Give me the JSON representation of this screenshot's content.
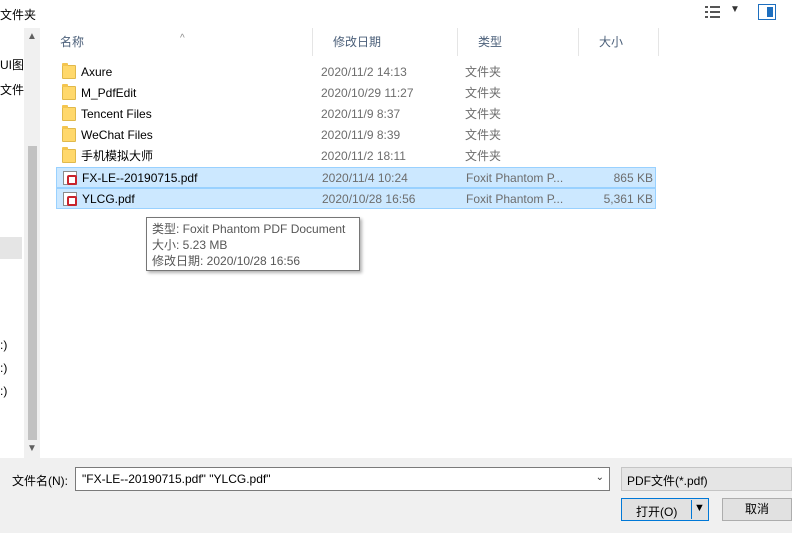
{
  "toolbar": {
    "left_label": "文件夹",
    "view_icon": "details-view-icon",
    "view_dropdown_icon": "chevron-down-icon",
    "preview_pane_icon": "preview-pane-icon"
  },
  "nav": {
    "items": [
      "UI图",
      "文件:",
      ":)",
      ":)",
      ":)"
    ]
  },
  "columns": {
    "name": "名称",
    "date": "修改日期",
    "type": "类型",
    "size": "大小"
  },
  "files": [
    {
      "name": "Axure",
      "date": "2020/11/2 14:13",
      "type": "文件夹",
      "size": "",
      "kind": "folder"
    },
    {
      "name": "M_PdfEdit",
      "date": "2020/10/29 11:27",
      "type": "文件夹",
      "size": "",
      "kind": "folder"
    },
    {
      "name": "Tencent Files",
      "date": "2020/11/9 8:37",
      "type": "文件夹",
      "size": "",
      "kind": "folder"
    },
    {
      "name": "WeChat Files",
      "date": "2020/11/9 8:39",
      "type": "文件夹",
      "size": "",
      "kind": "folder"
    },
    {
      "name": "手机模拟大师",
      "date": "2020/11/2 18:11",
      "type": "文件夹",
      "size": "",
      "kind": "folder"
    },
    {
      "name": "FX-LE--20190715.pdf",
      "date": "2020/11/4 10:24",
      "type": "Foxit Phantom P...",
      "size": "865 KB",
      "kind": "pdf",
      "selected": true
    },
    {
      "name": "YLCG.pdf",
      "date": "2020/10/28 16:56",
      "type": "Foxit Phantom P...",
      "size": "5,361 KB",
      "kind": "pdf",
      "selected": true
    }
  ],
  "tooltip": {
    "type_line": "类型: Foxit Phantom PDF Document",
    "size_line": "大小: 5.23 MB",
    "date_line": "修改日期: 2020/10/28 16:56"
  },
  "bottom": {
    "filename_label": "文件名(N):",
    "filename_value": "\"FX-LE--20190715.pdf\" \"YLCG.pdf\"",
    "filter_value": "PDF文件(*.pdf)",
    "open_label": "打开(O)",
    "cancel_label": "取消"
  },
  "colors": {
    "selection_bg": "#cce8ff",
    "selection_border": "#99d1ff",
    "accent": "#0078d7"
  }
}
